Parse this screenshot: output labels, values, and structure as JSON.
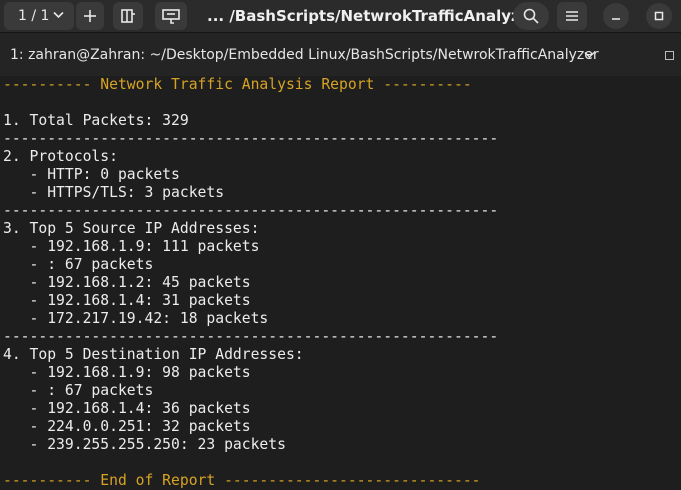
{
  "titlebar": {
    "tab_counter": "1 / 1",
    "title": "... /BashScripts/NetwrokTrafficAnalyzer"
  },
  "tabbar": {
    "tab_title": "1: zahran@Zahran: ~/Desktop/Embedded Linux/BashScripts/NetwrokTrafficAnalyzer"
  },
  "terminal": {
    "lines": [
      "---------- Network Traffic Analysis Report ----------",
      "",
      "1. Total Packets: 329",
      "--------------------------------------------------------",
      "2. Protocols:",
      "   - HTTP: 0 packets",
      "   - HTTPS/TLS: 3 packets",
      "--------------------------------------------------------",
      "3. Top 5 Source IP Addresses:",
      "   - 192.168.1.9: 111 packets",
      "   - : 67 packets",
      "   - 192.168.1.2: 45 packets",
      "   - 192.168.1.4: 31 packets",
      "   - 172.217.19.42: 18 packets",
      "--------------------------------------------------------",
      "4. Top 5 Destination IP Addresses:",
      "   - 192.168.1.9: 98 packets",
      "   - : 67 packets",
      "   - 192.168.1.4: 36 packets",
      "   - 224.0.0.251: 32 packets",
      "   - 239.255.255.250: 23 packets",
      "",
      "---------- End of Report -----------------------------"
    ]
  }
}
